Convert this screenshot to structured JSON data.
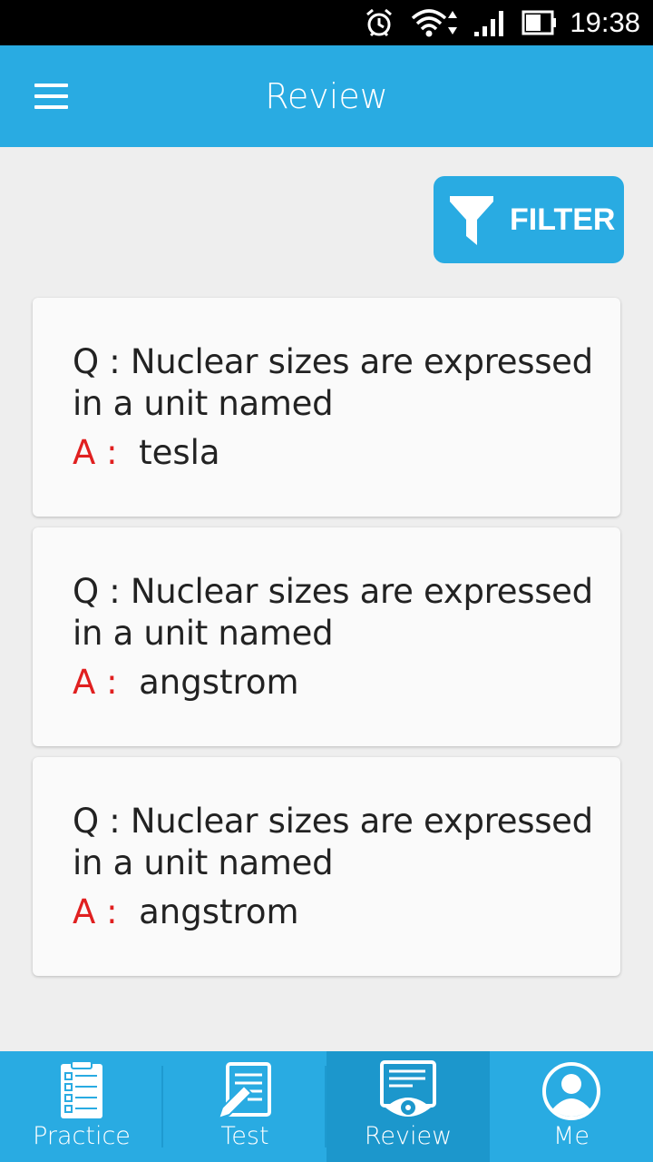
{
  "status_bar": {
    "time": "19:38",
    "icons": [
      "alarm-icon",
      "wifi-icon",
      "signal-icon",
      "battery-icon"
    ]
  },
  "header": {
    "title": "Review",
    "menu_icon": "hamburger-menu-icon"
  },
  "filter": {
    "label": "FILTER",
    "icon": "funnel-icon"
  },
  "review_items": [
    {
      "question_prefix": "Q :",
      "question": "Nuclear sizes are expressed in a unit named",
      "answer_prefix": "A :",
      "answer": "tesla"
    },
    {
      "question_prefix": "Q :",
      "question": "Nuclear sizes are expressed in a unit named",
      "answer_prefix": "A :",
      "answer": "angstrom"
    },
    {
      "question_prefix": "Q :",
      "question": "Nuclear sizes are expressed in a unit named",
      "answer_prefix": "A :",
      "answer": "angstrom"
    }
  ],
  "bottom_nav": {
    "tabs": [
      {
        "label": "Practice",
        "icon": "checklist-icon",
        "active": false
      },
      {
        "label": "Test",
        "icon": "test-pencil-icon",
        "active": false
      },
      {
        "label": "Review",
        "icon": "review-eye-icon",
        "active": true
      },
      {
        "label": "Me",
        "icon": "profile-icon",
        "active": false
      }
    ]
  },
  "colors": {
    "accent": "#29abe2",
    "active_tab": "#1c97cc",
    "answer_prefix": "#e02020",
    "background": "#eeeeee",
    "card": "#fafafa"
  }
}
